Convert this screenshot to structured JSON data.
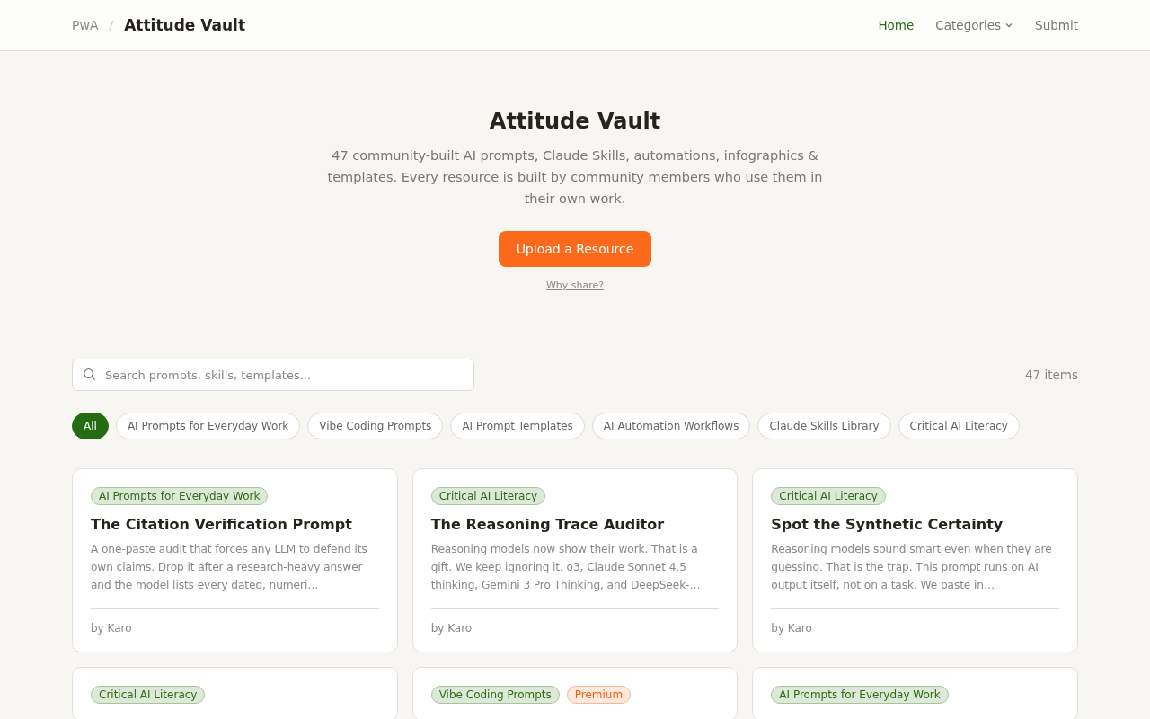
{
  "header": {
    "breadcrumb": "PwA",
    "separator": "/",
    "title": "Attitude Vault",
    "nav": [
      {
        "label": "Home",
        "selected": true,
        "dropdown": false
      },
      {
        "label": "Categories",
        "selected": false,
        "dropdown": true
      },
      {
        "label": "Submit",
        "selected": false,
        "dropdown": false
      }
    ]
  },
  "hero": {
    "title": "Attitude Vault",
    "description": "47 community-built AI prompts, Claude Skills, automations, infographics & templates. Every resource is built by community members who use them in their own work.",
    "button": "Upload a Resource",
    "link": "Why share?"
  },
  "search": {
    "placeholder": "Search prompts, skills, templates..."
  },
  "count": "47 items",
  "filters": [
    {
      "label": "All",
      "selected": true
    },
    {
      "label": "AI Prompts for Everyday Work",
      "selected": false
    },
    {
      "label": "Vibe Coding Prompts",
      "selected": false
    },
    {
      "label": "AI Prompt Templates",
      "selected": false
    },
    {
      "label": "AI Automation Workflows",
      "selected": false
    },
    {
      "label": "Claude Skills Library",
      "selected": false
    },
    {
      "label": "Critical AI Literacy",
      "selected": false
    }
  ],
  "cards": [
    {
      "tags": [
        {
          "label": "AI Prompts for Everyday Work",
          "kind": "category"
        }
      ],
      "title": "The Citation Verification Prompt",
      "description": "A one-paste audit that forces any LLM to defend its own claims. Drop it after a research-heavy answer and the model lists every dated, numeri…",
      "author": "by Karo"
    },
    {
      "tags": [
        {
          "label": "Critical AI Literacy",
          "kind": "category"
        }
      ],
      "title": "The Reasoning Trace Auditor",
      "description": "Reasoning models now show their work. That is a gift. We keep ignoring it. o3, Claude Sonnet 4.5 thinking, Gemini 3 Pro Thinking, and DeepSeek-…",
      "author": "by Karo"
    },
    {
      "tags": [
        {
          "label": "Critical AI Literacy",
          "kind": "category"
        }
      ],
      "title": "Spot the Synthetic Certainty",
      "description": "Reasoning models sound smart even when they are guessing. That is the trap. This prompt runs on AI output itself, not on a task. We paste in…",
      "author": "by Karo"
    },
    {
      "tags": [
        {
          "label": "Critical AI Literacy",
          "kind": "category"
        }
      ]
    },
    {
      "tags": [
        {
          "label": "Vibe Coding Prompts",
          "kind": "category"
        },
        {
          "label": "Premium",
          "kind": "premium"
        }
      ]
    },
    {
      "tags": [
        {
          "label": "AI Prompts for Everyday Work",
          "kind": "category"
        }
      ]
    }
  ]
}
